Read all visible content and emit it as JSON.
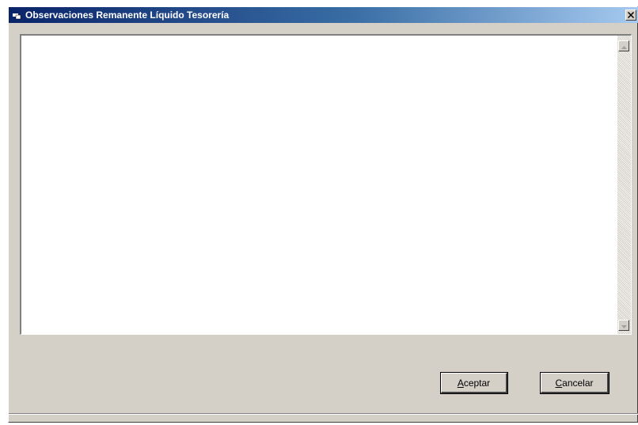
{
  "window": {
    "title": "Observaciones Remanente Líquido Tesorería",
    "app_icon": "window-app-icon",
    "close_label": "×"
  },
  "observations": {
    "value": ""
  },
  "buttons": {
    "accept_label": "Aceptar",
    "accept_accel": "A",
    "accept_rest": "ceptar",
    "cancel_label": "Cancelar",
    "cancel_accel": "C",
    "cancel_rest": "ancelar"
  },
  "colors": {
    "titlebar_start": "#0a246a",
    "titlebar_end": "#a6caf0",
    "face": "#d4d0c8"
  }
}
